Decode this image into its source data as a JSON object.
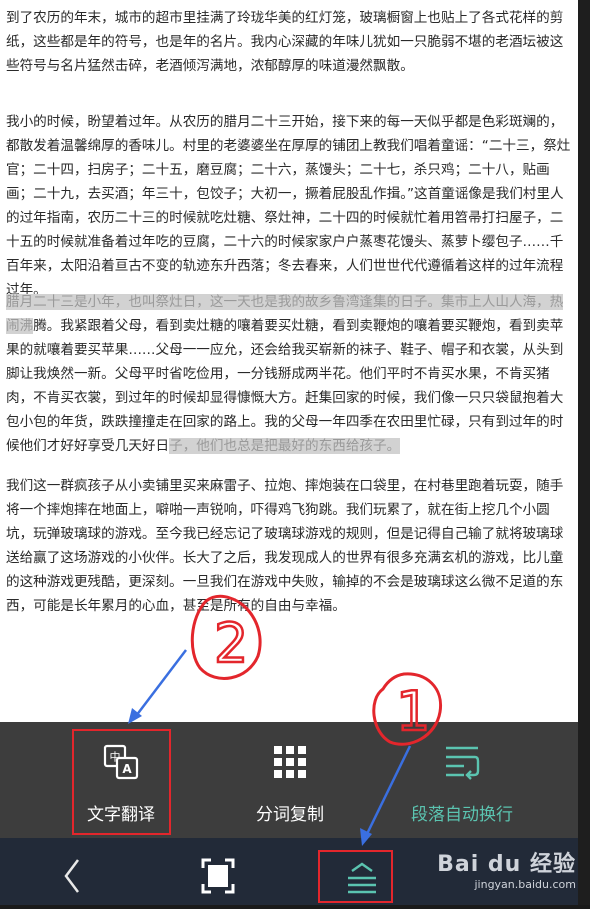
{
  "article": {
    "p1": "到了农历的年末，城市的超市里挂满了玲珑华美的红灯笼，玻璃橱窗上也贴上了各式花样的剪纸，这些都是年的符号，也是年的名片。我内心深藏的年味儿犹如一只脆弱不堪的老酒坛被这些符号与名片猛然击碎，老酒倾泻满地，浓郁醇厚的味道漫然飘散。",
    "p2": "我小的时候，盼望着过年。从农历的腊月二十三开始，接下来的每一天似乎都是色彩斑斓的，都散发着温馨绵厚的香味儿。村里的老婆婆坐在厚厚的铺团上教我们唱着童谣：“二十三，祭灶官；二十四，扫房子；二十五，磨豆腐；二十六，蒸馒头；二十七，杀只鸡；二十八，贴画画；二十九，去买酒；年三十，包饺子；大初一，撅着屁股乱作揖。”这首童谣像是我们村里人的过年指南，农历二十三的时候就吃灶糖、祭灶神，二十四的时候就忙着用笤帚打扫屋子，二十五的时候就准备着过年吃的豆腐，二十六的时候家家户户蒸枣花馒头、蒸萝卜缨包子……千百年来，太阳沿着亘古不变的轨迹东升西落；冬去春来，人们世世代代遵循着这样的过年流程过年。",
    "p3_hl": "腊月二十三是小年，也叫祭灶日，这一天也是我的故乡鲁湾逢集的日子。集市上人山人海，热闹沸",
    "p3_mid": "腾。我紧跟着父母，看到卖灶糖的嚷着要买灶糖，看到卖鞭炮的嚷着要买鞭炮，看到卖苹果的就嚷着要买苹果……父母一一应允，还会给我买崭新的袜子、鞋子、帽子和衣裳，从头到脚让我焕然一新。父母平时省吃俭用，一分钱掰成两半花。他们平时不肯买水果，不肯买猪肉，不肯买衣裳，到过年的时候却显得慷慨大方。赶集回家的时候，我们像一只只袋鼠抱着大包小包的年货，跌跌撞撞走在回家的路上。我的父母一年四季在农田里忙碌，只有到过年的时候他们才好好享受几天好日",
    "p3_tail": "子，他们也总是把最好的东西给孩子。",
    "p4": "我们这一群疯孩子从小卖铺里买来麻雷子、拉炮、摔炮装在口袋里，在村巷里跑着玩耍，随手将一个摔炮摔在地面上，噼啪一声锐响，吓得鸡飞狗跳。我们玩累了，就在街上挖几个小圆坑，玩弹玻璃球的游戏。至今我已经忘记了玻璃球游戏的规则，但是记得自己输了就将玻璃球送给赢了这场游戏的小伙伴。长大了之后，我发现成人的世界有很多充满玄机的游戏，比儿童的这种游戏更残酷，更深刻。一旦我们在游戏中失败，输掉的不会是玻璃球这么微不足道的东西，可能是长年累月的心血，甚至是所有的自由与幸福。"
  },
  "toolbar": {
    "translate_label": "文字翻译",
    "segment_copy_label": "分词复制",
    "auto_wrap_label": "段落自动换行"
  },
  "annotations": {
    "label_1": "1",
    "label_2": "2"
  },
  "watermark": {
    "brand": "Bai du 经验",
    "url": "jingyan.baidu.com"
  },
  "colors": {
    "toolbar_bg": "#3d3d3d",
    "nav_bg": "#222a38",
    "accent_teal": "#5bc4b0",
    "annotation_red": "#e3262c",
    "arrow_blue": "#3a6fe0",
    "highlight": "#d2d2d2"
  },
  "icons": {
    "translate": "translate-icon",
    "segment_copy": "grid-icon",
    "auto_wrap": "wrap-lines-icon",
    "back": "back-icon",
    "fullscreen": "fullscreen-icon",
    "menu": "menu-toggle-icon"
  }
}
